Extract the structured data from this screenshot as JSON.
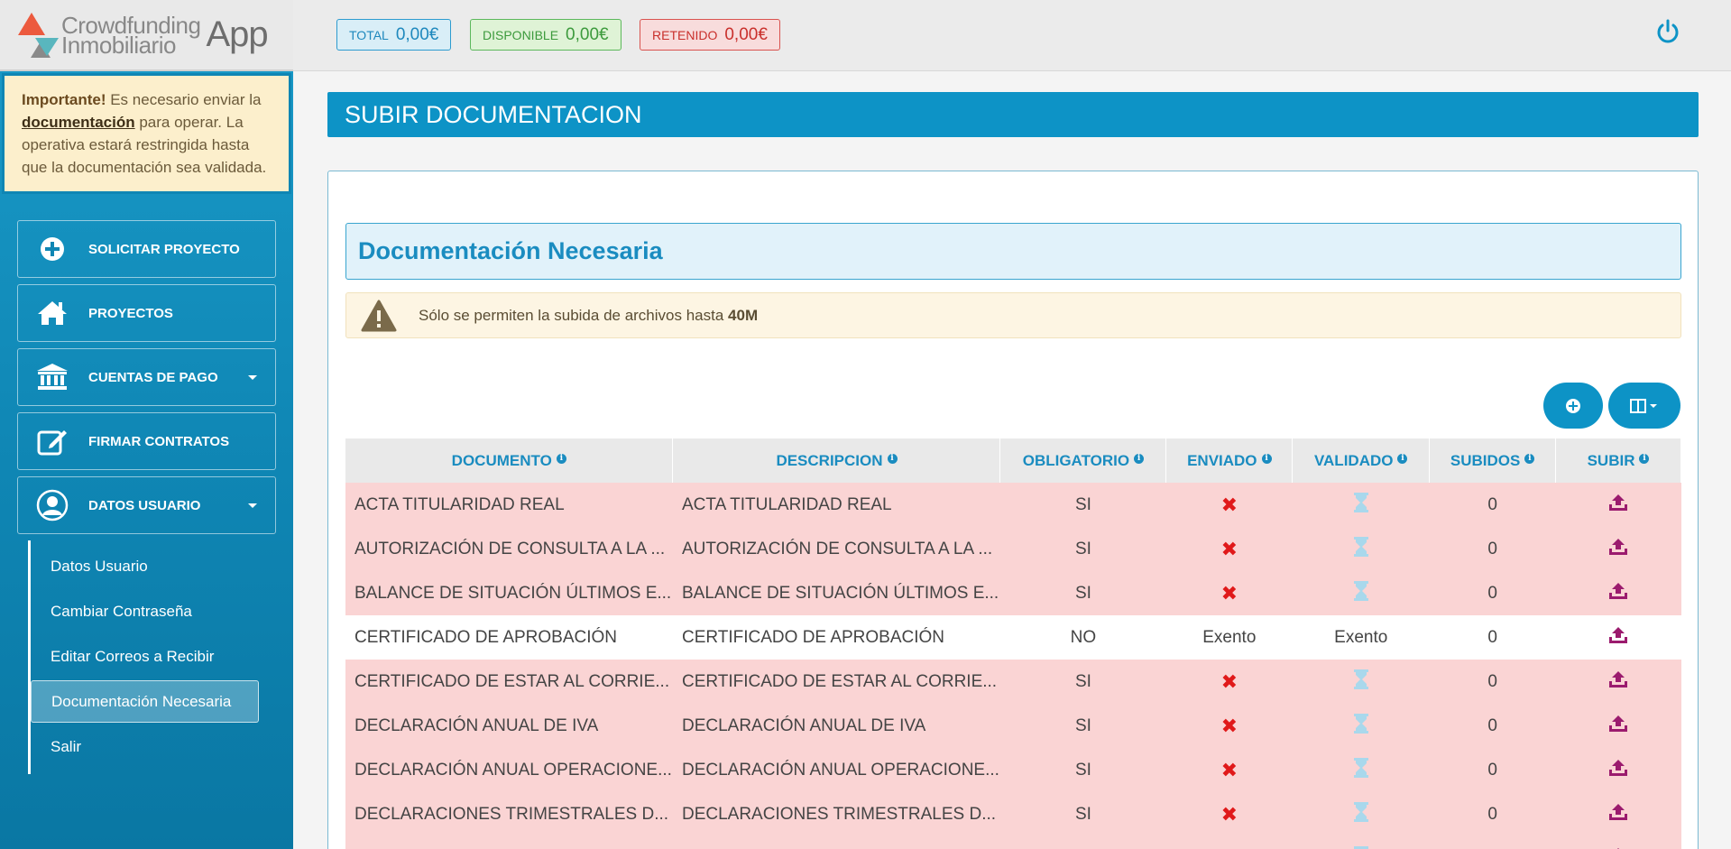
{
  "logo": {
    "line1": "Crowdfunding",
    "line2": "Inmobiliario",
    "app": "App"
  },
  "notice": {
    "strong": "Importante!",
    "text1": " Es necesario enviar la ",
    "link": "documentación",
    "text2": " para operar. La operativa estará restringida hasta que la documentación sea validada."
  },
  "menu": [
    {
      "label": "SOLICITAR PROYECTO",
      "icon": "plus-circle-icon"
    },
    {
      "label": "PROYECTOS",
      "icon": "home-icon"
    },
    {
      "label": "CUENTAS DE PAGO",
      "icon": "bank-icon",
      "caret": true
    },
    {
      "label": "FIRMAR CONTRATOS",
      "icon": "edit-icon"
    },
    {
      "label": "DATOS USUARIO",
      "icon": "user-icon",
      "caret": true
    }
  ],
  "submenu": [
    "Datos Usuario",
    "Cambiar Contraseña",
    "Editar Correos a Recibir",
    "Documentación Necesaria",
    "Salir"
  ],
  "balances": {
    "total_label": "TOTAL",
    "total_value": "0,00€",
    "disp_label": "DISPONIBLE",
    "disp_value": "0,00€",
    "ret_label": "RETENIDO",
    "ret_value": "0,00€"
  },
  "page_title": "SUBIR DOCUMENTACION",
  "section_title": "Documentación Necesaria",
  "warning": {
    "text": "Sólo se permiten la subida de archivos hasta ",
    "limit": "40M"
  },
  "table": {
    "headers": [
      "DOCUMENTO",
      "DESCRIPCION",
      "OBLIGATORIO",
      "ENVIADO",
      "VALIDADO",
      "SUBIDOS",
      "SUBIR"
    ],
    "rows": [
      {
        "documento": "ACTA TITULARIDAD REAL",
        "descripcion": "ACTA TITULARIDAD REAL",
        "obligatorio": "SI",
        "enviado": "x",
        "validado": "hourglass",
        "subidos": "0"
      },
      {
        "documento": "AUTORIZACIÓN DE CONSULTA A LA ...",
        "descripcion": "AUTORIZACIÓN DE CONSULTA A LA ...",
        "obligatorio": "SI",
        "enviado": "x",
        "validado": "hourglass",
        "subidos": "0"
      },
      {
        "documento": "BALANCE DE SITUACIÓN ÚLTIMOS E...",
        "descripcion": "BALANCE DE SITUACIÓN ÚLTIMOS E...",
        "obligatorio": "SI",
        "enviado": "x",
        "validado": "hourglass",
        "subidos": "0"
      },
      {
        "documento": "CERTIFICADO DE APROBACIÓN",
        "descripcion": "CERTIFICADO DE APROBACIÓN",
        "obligatorio": "NO",
        "enviado": "Exento",
        "validado": "Exento",
        "subidos": "0"
      },
      {
        "documento": "CERTIFICADO DE ESTAR AL CORRIE...",
        "descripcion": "CERTIFICADO DE ESTAR AL CORRIE...",
        "obligatorio": "SI",
        "enviado": "x",
        "validado": "hourglass",
        "subidos": "0"
      },
      {
        "documento": "DECLARACIÓN ANUAL DE IVA",
        "descripcion": "DECLARACIÓN ANUAL DE IVA",
        "obligatorio": "SI",
        "enviado": "x",
        "validado": "hourglass",
        "subidos": "0"
      },
      {
        "documento": "DECLARACIÓN ANUAL OPERACIONE...",
        "descripcion": "DECLARACIÓN ANUAL OPERACIONE...",
        "obligatorio": "SI",
        "enviado": "x",
        "validado": "hourglass",
        "subidos": "0"
      },
      {
        "documento": "DECLARACIONES TRIMESTRALES D...",
        "descripcion": "DECLARACIONES TRIMESTRALES D...",
        "obligatorio": "SI",
        "enviado": "x",
        "validado": "hourglass",
        "subidos": "0"
      },
      {
        "documento": "",
        "descripcion": "",
        "obligatorio": "",
        "enviado": "",
        "validado": "hourglass",
        "subidos": ""
      }
    ]
  },
  "colors": {
    "accent": "#0d93c6",
    "pending_row": "#fad4d4",
    "upload_icon": "#9b1b6e",
    "hourglass": "#a9d8ec",
    "x_mark": "#e0191a"
  }
}
